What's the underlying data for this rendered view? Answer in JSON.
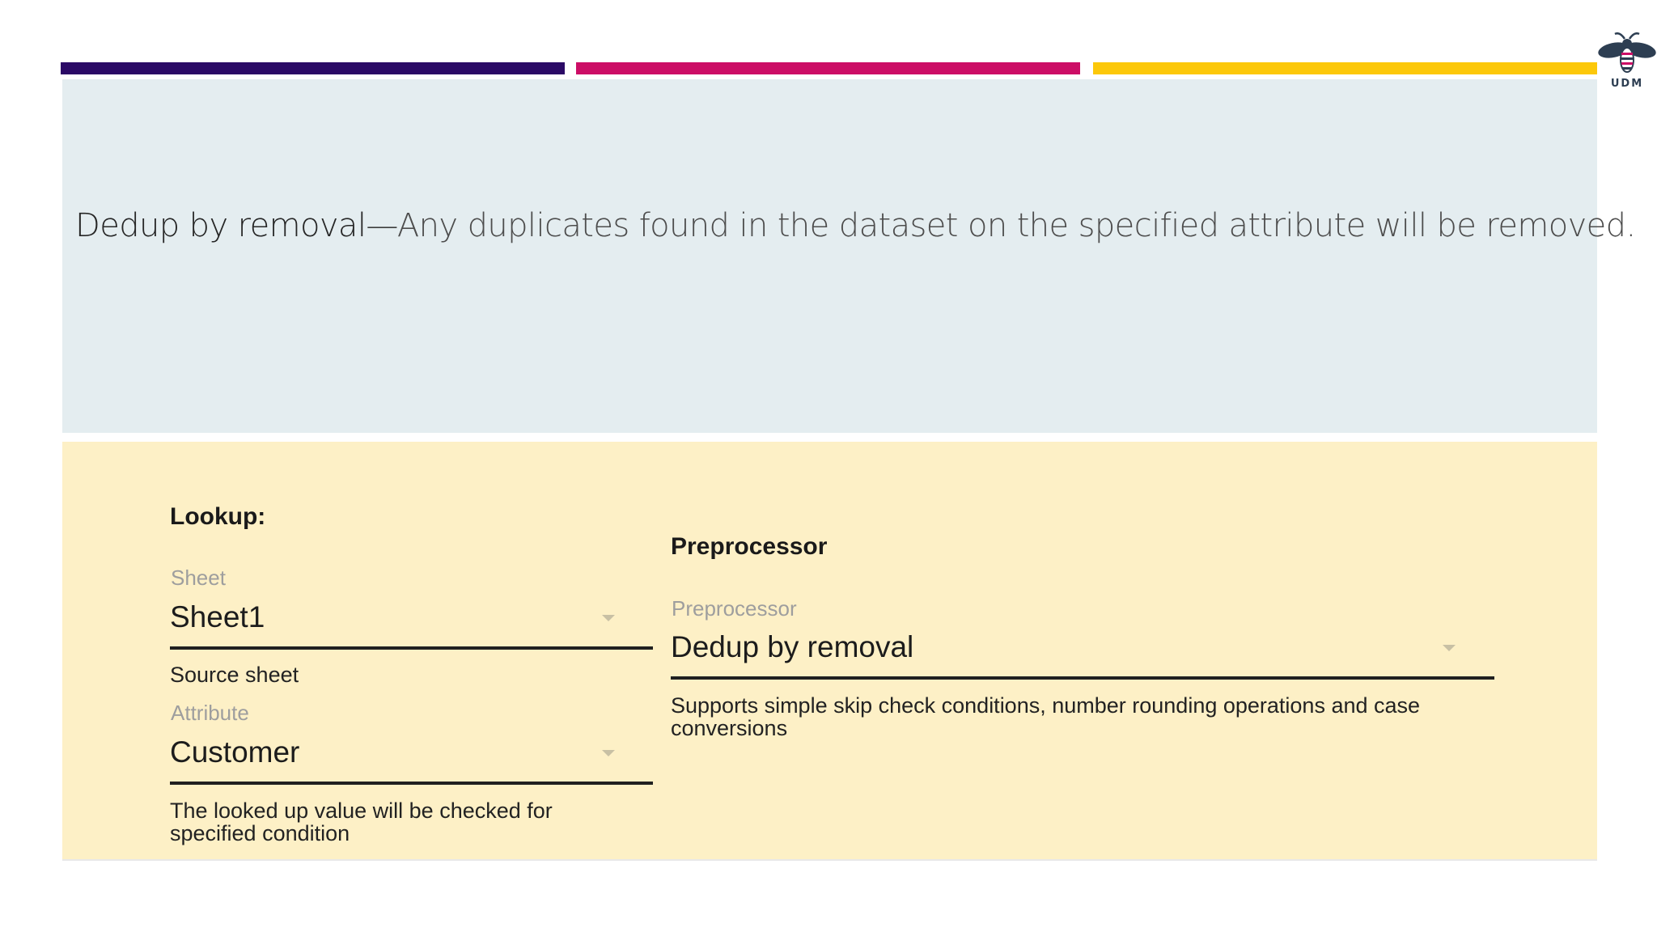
{
  "slide": {
    "headline_strong": "Dedup by removal",
    "headline_dash": "—",
    "headline_rest": "Any duplicates found in the dataset on the specified attribute will be removed.",
    "logo_text": "UDM"
  },
  "colors": {
    "bar_1": "#2b0a66",
    "bar_2": "#cc0e66",
    "bar_3": "#fcc80a",
    "top_panel": "#e4edf0",
    "bottom_panel": "#fdf0c6"
  },
  "lookup": {
    "title": "Lookup:",
    "sheet_label": "Sheet",
    "sheet_value": "Sheet1",
    "sheet_hint": "Source sheet",
    "attribute_label": "Attribute",
    "attribute_value": "Customer",
    "attribute_hint": "The looked up value will be checked for specified condition"
  },
  "preprocessor": {
    "title": "Preprocessor",
    "label": "Preprocessor",
    "value": "Dedup by removal",
    "hint": "Supports simple skip check conditions, number rounding operations and case conversions"
  },
  "icons": [
    "bee-logo-icon",
    "chevron-down-icon"
  ]
}
